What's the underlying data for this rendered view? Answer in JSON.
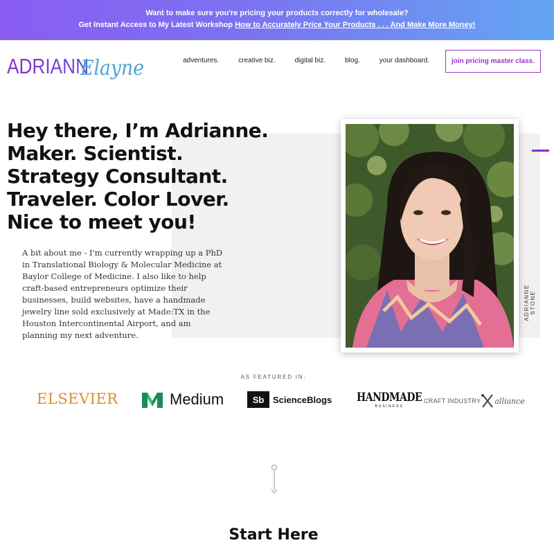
{
  "banner": {
    "line1": "Want to make sure you're pricing your products correctly for wholesale?",
    "line2_prefix": "Get Instant Access to My Latest Workshop",
    "line2_link": "How to Accurately Price Your Products . . . And Make More Money!"
  },
  "logo": {
    "part1": "ADRIANN",
    "part2": "Elayne"
  },
  "nav": {
    "items": [
      "adventures.",
      "creative biz.",
      "digital biz.",
      "blog.",
      "your dashboard."
    ],
    "cta": "join pricing master class."
  },
  "hero": {
    "headline": [
      "Hey there, I’m Adrianne.",
      "Maker. Scientist.",
      "Strategy Consultant.",
      "Traveler. Color Lover.",
      "Nice to meet you!"
    ],
    "about": "A bit about me - I'm currently wrapping up a PhD in Translational Biology & Molecular Medicine at Baylor College of Medicine. I also like to help craft-based entrepreneurs optimize their businesses, build websites, have a handmade jewelry line sold exclusively at Made:TX in the Houston Intercontinental Airport, and am planning my next adventure.",
    "photo_caption": "ADRIANNE STONE"
  },
  "featured": {
    "label": "AS FEATURED IN:",
    "logos": {
      "elsevier": "ELSEVIER",
      "medium": "Medium",
      "scienceblogs_mark": "Sb",
      "scienceblogs": "ScienceBlogs",
      "handmade": "HANDMADE",
      "handmade_sub": "BUSINESS",
      "craft_a": "CRAFT INDUSTRY",
      "craft_b": "alliance"
    }
  },
  "start_here": "Start Here",
  "colors": {
    "accent_purple": "#9b35c9",
    "banner_gradient_start": "#8a5cf2",
    "banner_gradient_end": "#63a6f2",
    "logo_purple": "#8a2bd1",
    "logo_blue": "#4fa3d6"
  }
}
